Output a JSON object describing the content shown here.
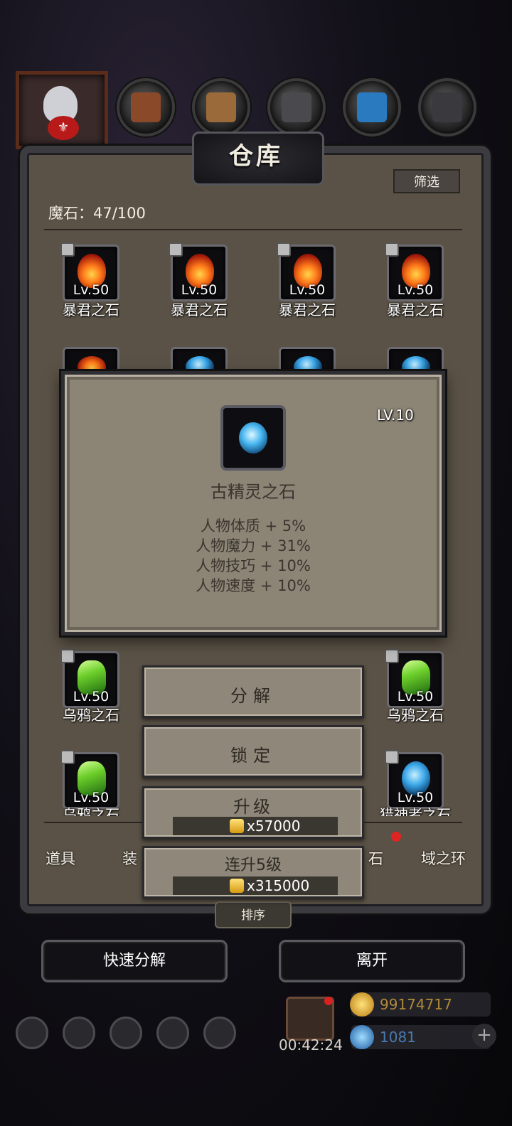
{
  "warehouse": {
    "title": "仓库",
    "filter_label": "筛选",
    "count_label": "魔石：47/100"
  },
  "items_row1": [
    {
      "level": "Lv.50",
      "name": "暴君之石",
      "gem": "fire"
    },
    {
      "level": "Lv.50",
      "name": "暴君之石",
      "gem": "fire"
    },
    {
      "level": "Lv.50",
      "name": "暴君之石",
      "gem": "fire"
    },
    {
      "level": "Lv.50",
      "name": "暴君之石",
      "gem": "fire"
    }
  ],
  "items_row5": [
    {
      "level": "Lv.50",
      "name": "乌鸦之石",
      "gem": "green"
    },
    {
      "level": "Lv.50",
      "name": "乌鸦之石",
      "gem": "green"
    }
  ],
  "items_row6": [
    {
      "level": "Lv.50",
      "name": "乌鸦之石",
      "gem": "green"
    },
    {
      "level": "Lv.50",
      "name": "猎神者之石",
      "gem": "blue"
    }
  ],
  "popup": {
    "level": "LV.10",
    "name": "古精灵之石",
    "stats": [
      "人物体质 + 5%",
      "人物魔力 + 31%",
      "人物技巧 + 10%",
      "人物速度 + 10%"
    ]
  },
  "actions": {
    "decompose": "分解",
    "lock": "锁定",
    "upgrade": "升级",
    "upgrade_cost": "x57000",
    "upgrade5": "连升5级",
    "upgrade5_cost": "x315000"
  },
  "bottom_tabs": [
    "道具",
    "装",
    "石",
    "域之环"
  ],
  "sort_label": "排序",
  "quick_decompose": "快速分解",
  "leave": "离开",
  "hud": {
    "timer": "00:42:24",
    "gold": "99174717",
    "gems": "1081"
  },
  "colors": {
    "panel": "#5a5246",
    "popup": "#8c8576",
    "accent_red": "#e02424",
    "gold": "#d69a12"
  }
}
